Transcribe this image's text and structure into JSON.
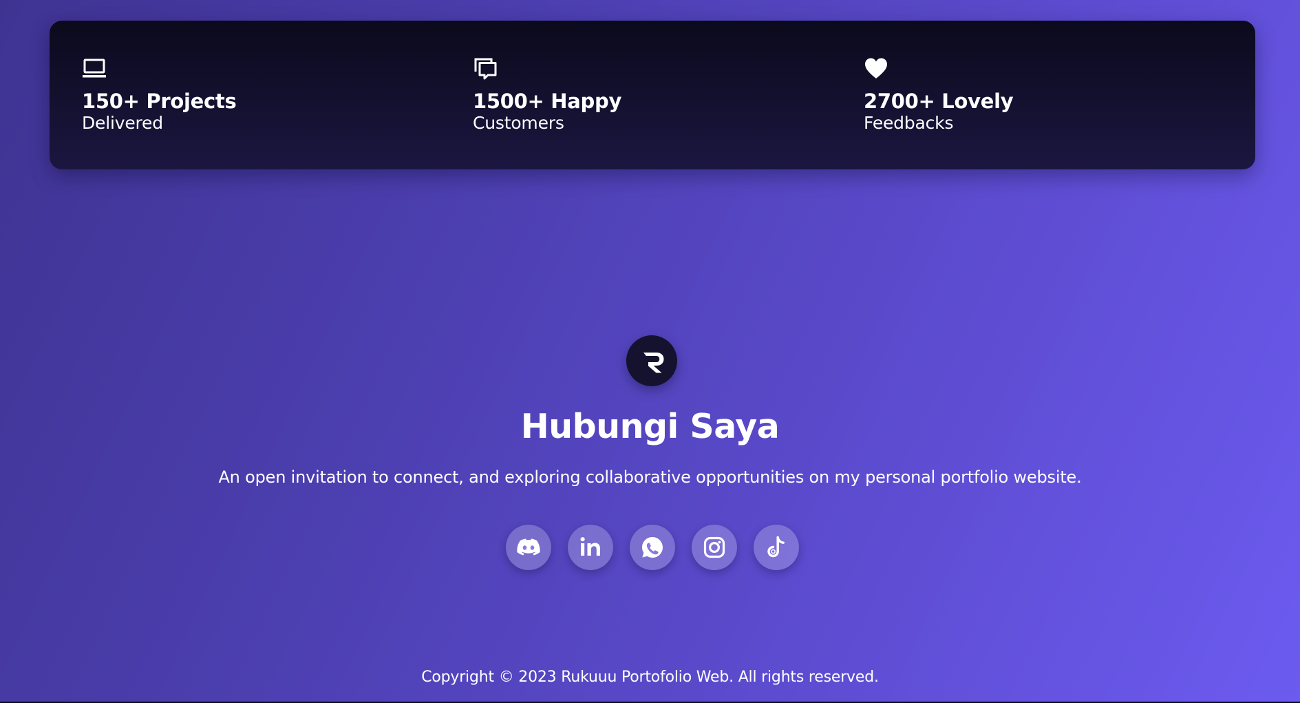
{
  "stats": [
    {
      "icon": "laptop-icon",
      "title": "150+ Projects",
      "subtitle": "Delivered"
    },
    {
      "icon": "chat-bubbles-icon",
      "title": "1500+ Happy",
      "subtitle": "Customers"
    },
    {
      "icon": "heart-icon",
      "title": "2700+ Lovely",
      "subtitle": "Feedbacks"
    }
  ],
  "contact": {
    "logo_icon": "r-logo-icon",
    "title": "Hubungi Saya",
    "description": "An open invitation to connect, and exploring collaborative opportunities on my personal portfolio website.",
    "socials": [
      {
        "icon": "discord-icon"
      },
      {
        "icon": "linkedin-icon"
      },
      {
        "icon": "whatsapp-icon"
      },
      {
        "icon": "instagram-icon"
      },
      {
        "icon": "tiktok-icon"
      }
    ]
  },
  "footer": {
    "copyright": "Copyright © 2023 Rukuuu Portofolio Web. All rights reserved."
  },
  "colors": {
    "background_start": "#3f3392",
    "background_end": "#6c5bf0",
    "panel": "#0b0a1c",
    "logo_circle": "#15122f"
  }
}
